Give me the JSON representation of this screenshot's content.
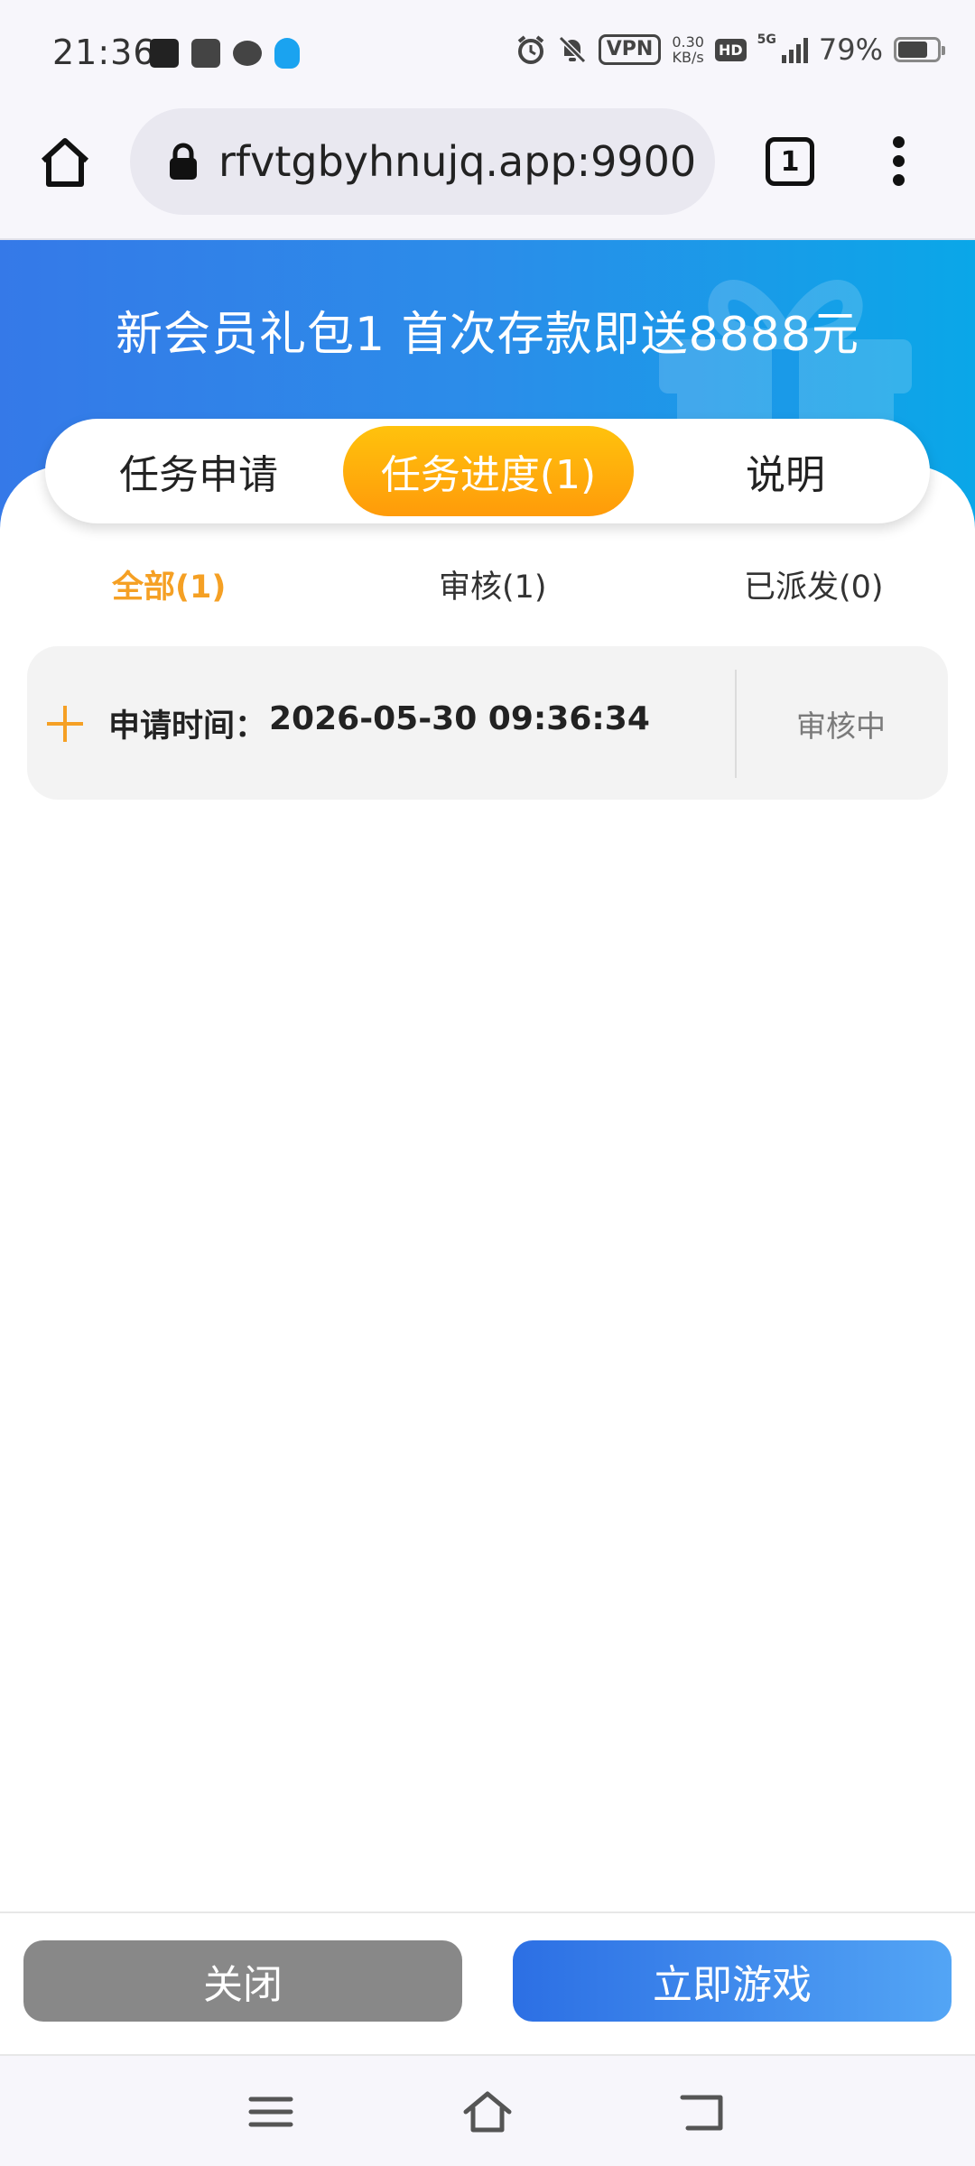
{
  "status_bar": {
    "time": "21:36",
    "left_icons": [
      "soul-app-icon",
      "bag-app-icon",
      "chat-app-icon",
      "qq-app-icon"
    ],
    "vpn_label": "VPN",
    "speed_value": "0.30",
    "speed_unit": "KB/s",
    "hd_label": "HD",
    "network_label": "5G",
    "battery_percent": "79%",
    "battery_level": 0.79
  },
  "browser": {
    "url": "rfvtgbyhnujq.app:9900",
    "tab_count": "1"
  },
  "banner": {
    "title": "新会员礼包1 首次存款即送8888元"
  },
  "top_tabs": [
    {
      "label": "任务申请",
      "active": false
    },
    {
      "label": "任务进度(1)",
      "active": true
    },
    {
      "label": "说明",
      "active": false
    }
  ],
  "sub_tabs": [
    {
      "label": "全部(1)",
      "active": true
    },
    {
      "label": "审核(1)",
      "active": false
    },
    {
      "label": "已派发(0)",
      "active": false
    }
  ],
  "records": [
    {
      "label": "申请时间：",
      "value": "2026-05-30 09:36:34",
      "status": "审核中"
    }
  ],
  "actions": {
    "close_label": "关闭",
    "play_label": "立即游戏"
  },
  "colors": {
    "accent_orange": "#f5a024",
    "banner_blue": "#2b8de9",
    "button_grey": "#888888",
    "button_blue": "#2c6fe4"
  }
}
